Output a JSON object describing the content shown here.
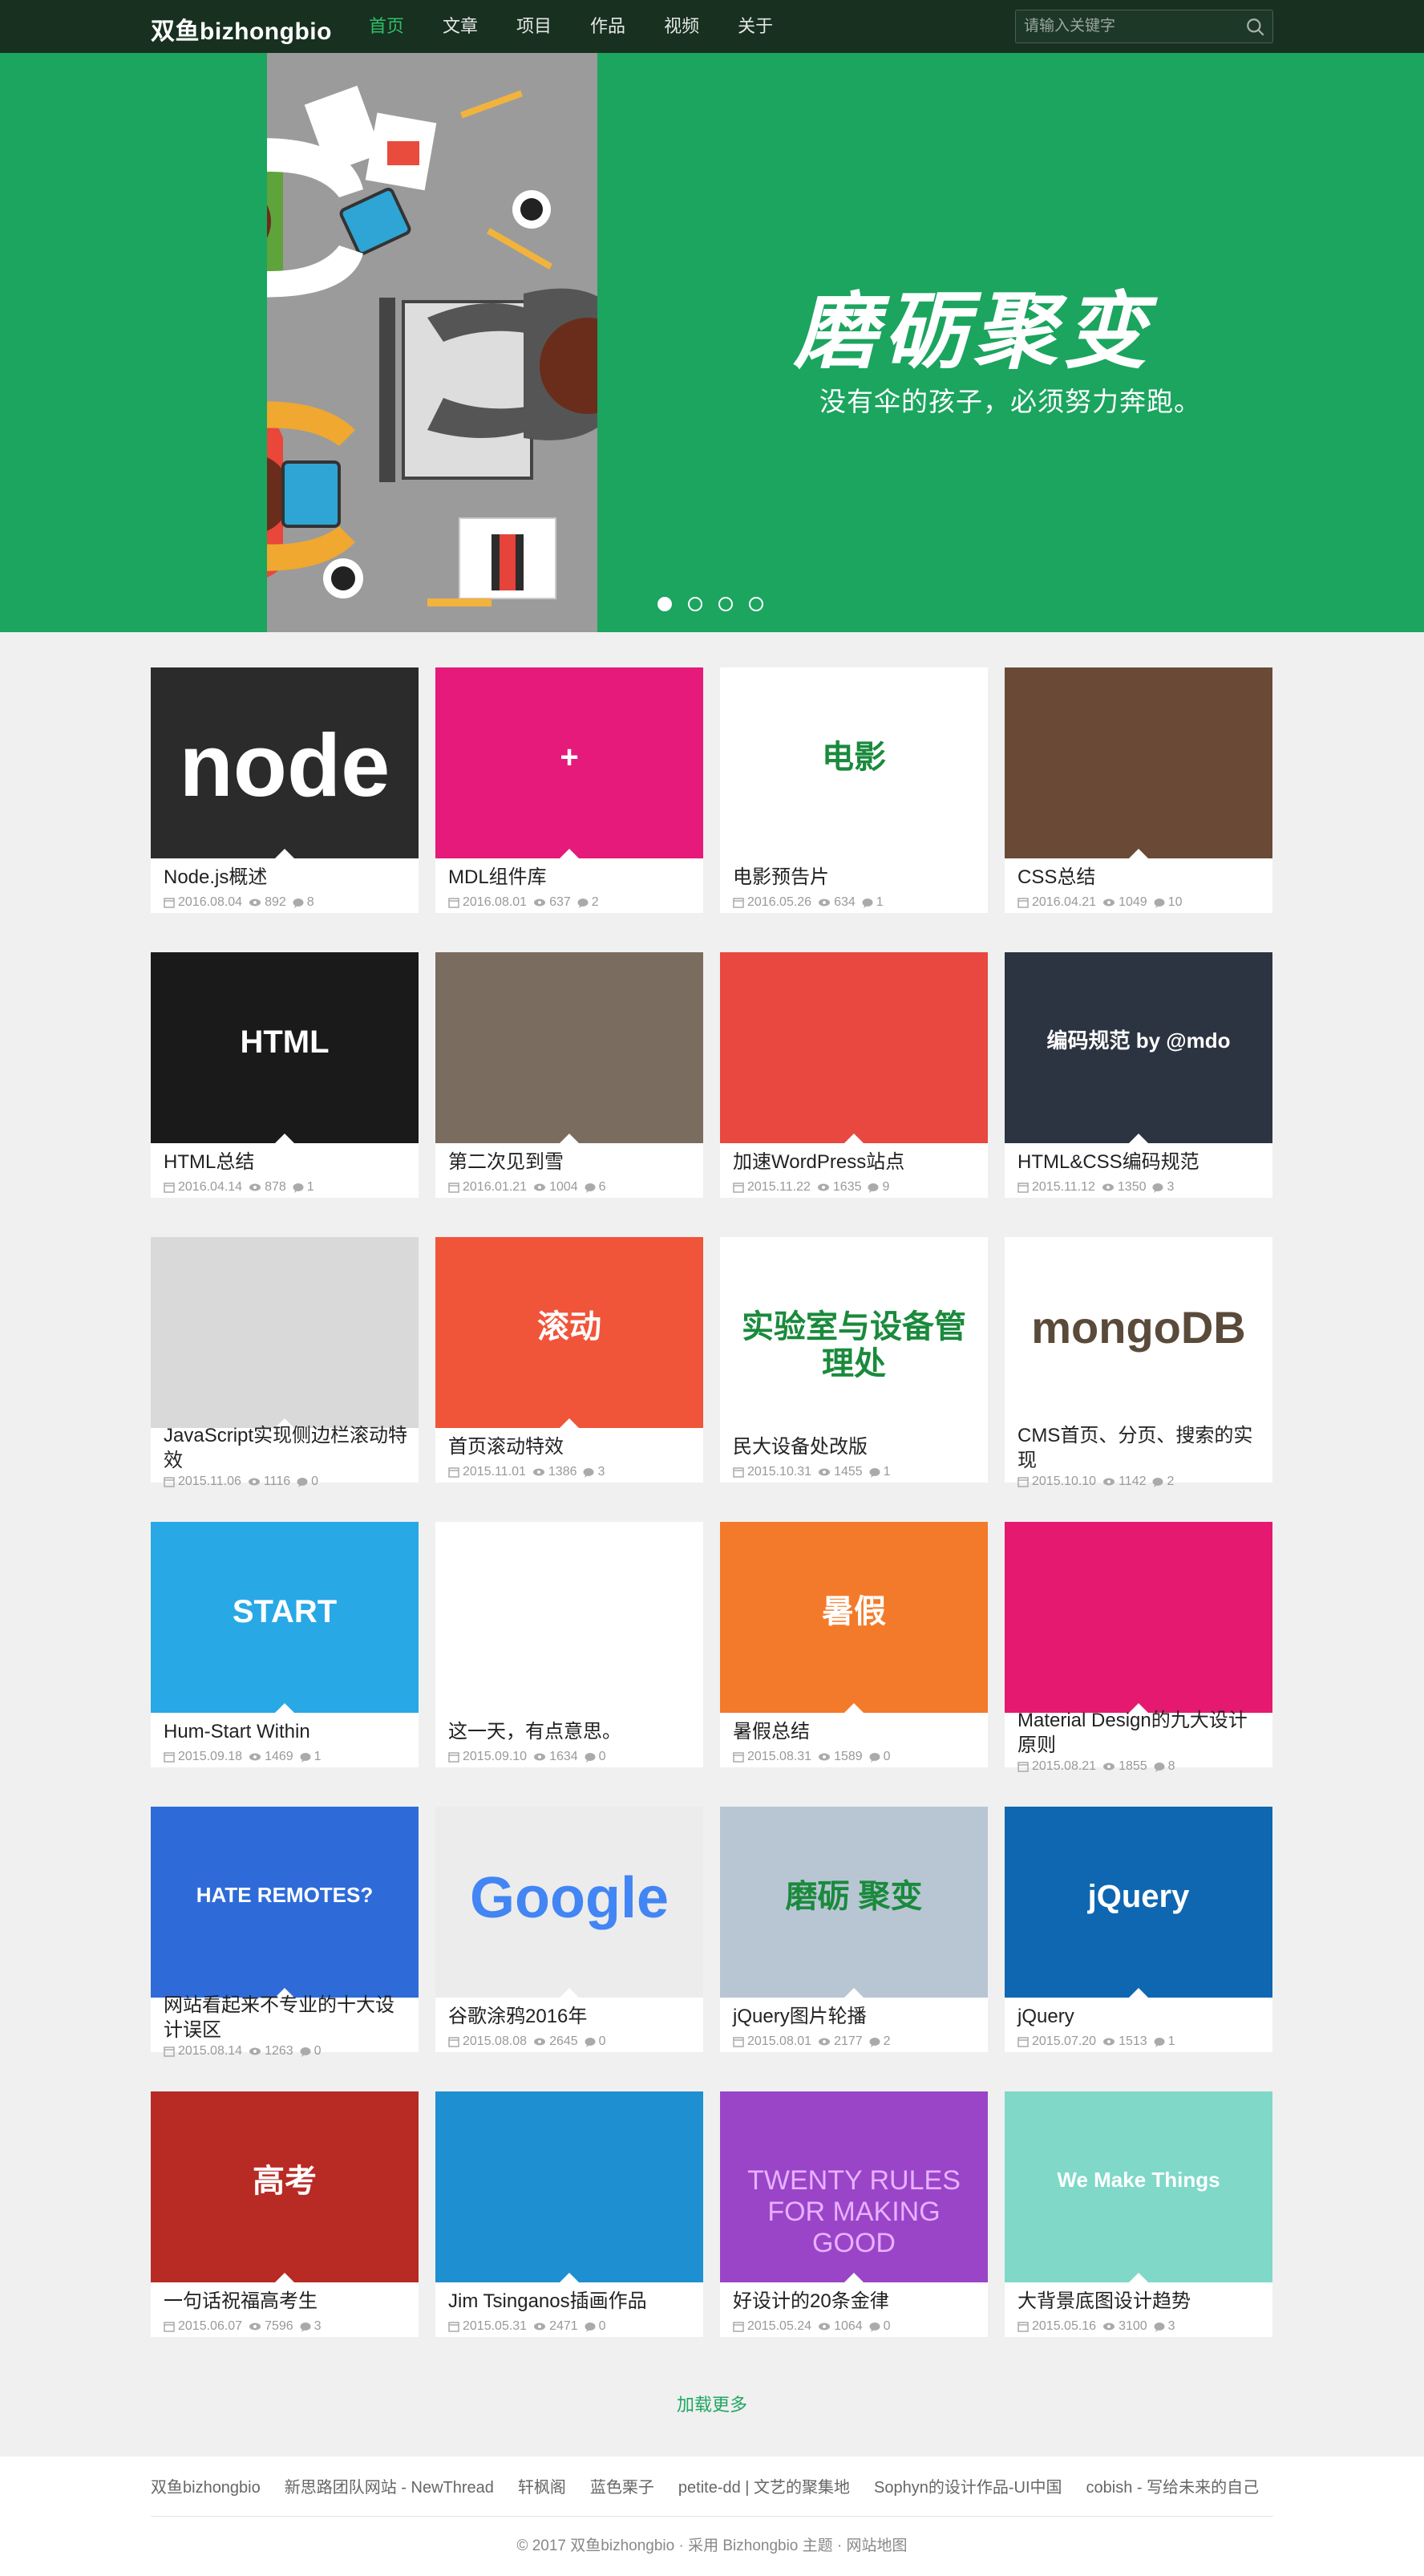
{
  "nav": {
    "brand": "双鱼bizhongbio",
    "items": [
      "首页",
      "文章",
      "项目",
      "作品",
      "视频",
      "关于"
    ],
    "search_placeholder": "请输入关键字"
  },
  "hero": {
    "title": "磨砺聚变",
    "subtitle": "没有伞的孩子，必须努力奔跑。",
    "slide_count": 4,
    "active_slide": 1
  },
  "cards": [
    {
      "title": "Node.js概述",
      "date": "2016.08.04",
      "views": "892",
      "comments": "8",
      "bg": "#2b2b2b",
      "thumb_text": "node"
    },
    {
      "title": "MDL组件库",
      "date": "2016.08.01",
      "views": "637",
      "comments": "2",
      "bg": "#e51a7a",
      "thumb_text": "+"
    },
    {
      "title": "电影预告片",
      "date": "2016.05.26",
      "views": "634",
      "comments": "1",
      "bg": "#ffffff",
      "thumb_text": "电影"
    },
    {
      "title": "CSS总结",
      "date": "2016.04.21",
      "views": "1049",
      "comments": "10",
      "bg": "#6a4a36",
      "thumb_text": ""
    },
    {
      "title": "HTML总结",
      "date": "2016.04.14",
      "views": "878",
      "comments": "1",
      "bg": "#1a1a1a",
      "thumb_text": "HTML"
    },
    {
      "title": "第二次见到雪",
      "date": "2016.01.21",
      "views": "1004",
      "comments": "6",
      "bg": "#7b6c60",
      "thumb_text": ""
    },
    {
      "title": "加速WordPress站点",
      "date": "2015.11.22",
      "views": "1635",
      "comments": "9",
      "bg": "#e8483f",
      "thumb_text": ""
    },
    {
      "title": "HTML&CSS编码规范",
      "date": "2015.11.12",
      "views": "1350",
      "comments": "3",
      "bg": "#2d3441",
      "thumb_text": "编码规范 by @mdo"
    },
    {
      "title": "JavaScript实现侧边栏滚动特效",
      "date": "2015.11.06",
      "views": "1116",
      "comments": "0",
      "bg": "#d9d9d9",
      "thumb_text": ""
    },
    {
      "title": "首页滚动特效",
      "date": "2015.11.01",
      "views": "1386",
      "comments": "3",
      "bg": "#f0553a",
      "thumb_text": "滚动"
    },
    {
      "title": "民大设备处改版",
      "date": "2015.10.31",
      "views": "1455",
      "comments": "1",
      "bg": "#ffffff",
      "thumb_text": "实验室与设备管理处"
    },
    {
      "title": "CMS首页、分页、搜索的实现",
      "date": "2015.10.10",
      "views": "1142",
      "comments": "2",
      "bg": "#ffffff",
      "thumb_text": "mongoDB"
    },
    {
      "title": "Hum-Start Within",
      "date": "2015.09.18",
      "views": "1469",
      "comments": "1",
      "bg": "#29a8e6",
      "thumb_text": "START"
    },
    {
      "title": "这一天，有点意思。",
      "date": "2015.09.10",
      "views": "1634",
      "comments": "0",
      "bg": "#ffffff",
      "thumb_text": ""
    },
    {
      "title": "暑假总结",
      "date": "2015.08.31",
      "views": "1589",
      "comments": "0",
      "bg": "#f37a2a",
      "thumb_text": "暑假"
    },
    {
      "title": "Material Design的九大设计原则",
      "date": "2015.08.21",
      "views": "1855",
      "comments": "8",
      "bg": "#e5196f",
      "thumb_text": ""
    },
    {
      "title": "网站看起来不专业的十大设计误区",
      "date": "2015.08.14",
      "views": "1263",
      "comments": "0",
      "bg": "#2e6bd9",
      "thumb_text": "HATE REMOTES?"
    },
    {
      "title": "谷歌涂鸦2016年",
      "date": "2015.08.08",
      "views": "2645",
      "comments": "0",
      "bg": "#ececec",
      "thumb_text": "Google"
    },
    {
      "title": "jQuery图片轮播",
      "date": "2015.08.01",
      "views": "2177",
      "comments": "2",
      "bg": "#b8c6d4",
      "thumb_text": "磨砺 聚变"
    },
    {
      "title": "jQuery",
      "date": "2015.07.20",
      "views": "1513",
      "comments": "1",
      "bg": "#0f67b1",
      "thumb_text": "jQuery"
    },
    {
      "title": "一句话祝福高考生",
      "date": "2015.06.07",
      "views": "7596",
      "comments": "3",
      "bg": "#b82a24",
      "thumb_text": "高考"
    },
    {
      "title": "Jim Tsinganos插画作品",
      "date": "2015.05.31",
      "views": "2471",
      "comments": "0",
      "bg": "#1e8fd0",
      "thumb_text": ""
    },
    {
      "title": "好设计的20条金律",
      "date": "2015.05.24",
      "views": "1064",
      "comments": "0",
      "bg": "#9a45c8",
      "thumb_text": "TWENTY RULES FOR MAKING GOOD"
    },
    {
      "title": "大背景底图设计趋势",
      "date": "2015.05.16",
      "views": "3100",
      "comments": "3",
      "bg": "#7fd8c8",
      "thumb_text": "We Make Things"
    }
  ],
  "load_more": "加载更多",
  "footer": {
    "links": [
      "双鱼bizhongbio",
      "新思路团队网站 - NewThread",
      "轩枫阁",
      "蓝色栗子",
      "petite-dd | 文艺的聚集地",
      "Sophyn的设计作品-UI中国",
      "cobish - 写给未来的自己"
    ],
    "copyright": "© 2017 双鱼bizhongbio · 采用 Bizhongbio 主题 · 网站地图"
  }
}
